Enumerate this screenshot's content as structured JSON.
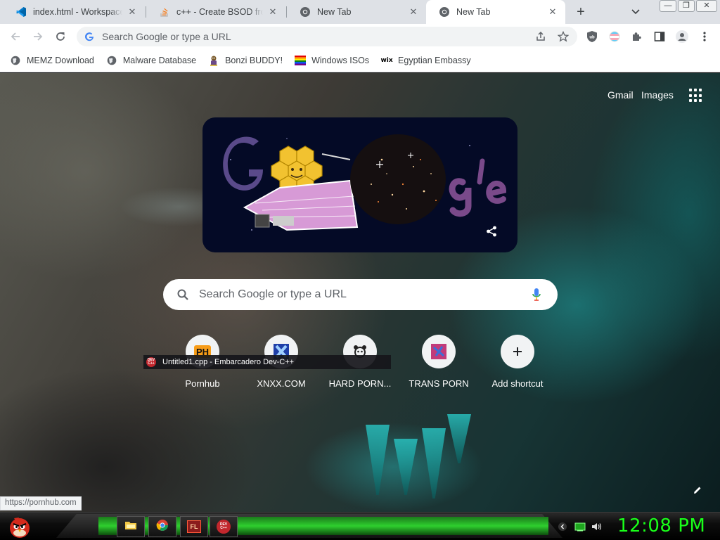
{
  "browser": {
    "tabs": [
      {
        "title": "index.html - Workspace",
        "icon": "vscode-icon",
        "active": false
      },
      {
        "title": "c++ - Create BSOD from",
        "icon": "stackoverflow-icon",
        "active": false
      },
      {
        "title": "New Tab",
        "icon": "chrome-icon",
        "active": false
      },
      {
        "title": "New Tab",
        "icon": "chrome-icon",
        "active": true
      }
    ],
    "omnibox_placeholder": "Search Google or type a URL",
    "bookmarks": [
      {
        "label": "MEMZ Download",
        "icon": "globe-icon"
      },
      {
        "label": "Malware Database",
        "icon": "globe-icon"
      },
      {
        "label": "Bonzi BUDDY!",
        "icon": "bonzi-icon"
      },
      {
        "label": "Windows ISOs",
        "icon": "windows-flag-icon"
      },
      {
        "label": "Egyptian Embassy",
        "icon": "wix-icon"
      }
    ],
    "status_url": "https://pornhub.com"
  },
  "newtab": {
    "header_links": {
      "gmail": "Gmail",
      "images": "Images"
    },
    "search_placeholder": "Search Google or type a URL",
    "shortcuts": [
      {
        "label": "Pornhub",
        "icon": "pornhub-icon",
        "icon_text": "PH"
      },
      {
        "label": "XNXX.COM",
        "icon": "xnxx-icon"
      },
      {
        "label": "HARD PORN...",
        "icon": "hardporn-icon"
      },
      {
        "label": "TRANS PORN",
        "icon": "transporn-icon"
      },
      {
        "label": "Add shortcut",
        "icon": "plus-icon"
      }
    ]
  },
  "tooltip": {
    "text": "Untitled1.cpp - Embarcadero Dev-C++",
    "icon_text": "DEV C++"
  },
  "taskbar": {
    "apps": [
      {
        "name": "file-explorer",
        "icon": "folder-icon"
      },
      {
        "name": "chrome",
        "icon": "chrome-icon"
      },
      {
        "name": "fl-studio",
        "icon": "fl-studio-icon",
        "icon_text": "FL"
      },
      {
        "name": "dev-cpp",
        "icon": "devcpp-icon",
        "icon_text": "DEV C++"
      }
    ],
    "tray": [
      "chevron-icon",
      "battery-icon",
      "volume-icon"
    ],
    "clock": "12:08 PM"
  },
  "colors": {
    "clock": "#19ff19",
    "taskbar_glow": "#2ecf2e",
    "doodle_bg": "#040a26"
  }
}
